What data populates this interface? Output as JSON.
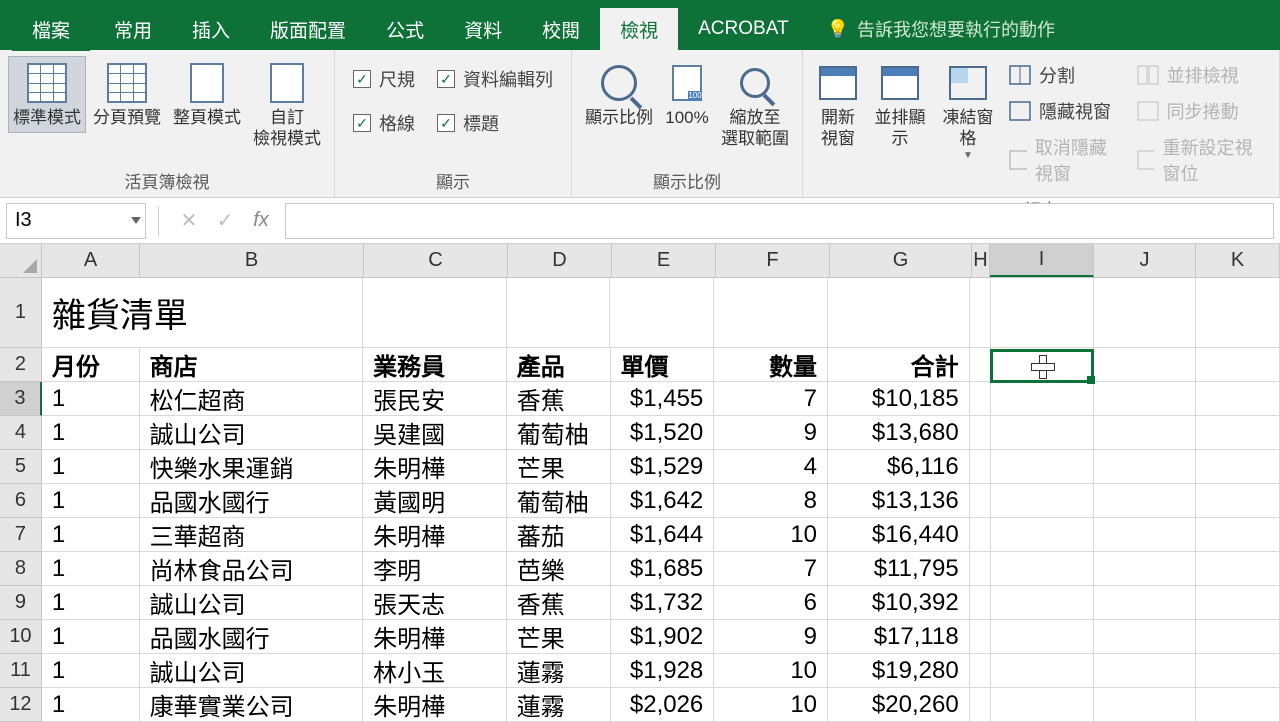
{
  "tabs": {
    "file": "檔案",
    "home": "常用",
    "insert": "插入",
    "layout": "版面配置",
    "formulas": "公式",
    "data": "資料",
    "review": "校閱",
    "view": "檢視",
    "acrobat": "ACROBAT",
    "tellme": "告訴我您想要執行的動作"
  },
  "ribbon": {
    "views": {
      "normal": "標準模式",
      "pagebreak": "分頁預覽",
      "pagelayout": "整頁模式",
      "custom": "自訂\n檢視模式",
      "group": "活頁簿檢視"
    },
    "show": {
      "ruler": "尺規",
      "formulabar": "資料編輯列",
      "gridlines": "格線",
      "headings": "標題",
      "group": "顯示"
    },
    "zoom": {
      "zoom": "顯示比例",
      "hundred": "100%",
      "selection": "縮放至\n選取範圍",
      "group": "顯示比例"
    },
    "window": {
      "new": "開新\n視窗",
      "arrange": "並排顯示",
      "freeze": "凍結窗格",
      "split": "分割",
      "hide": "隱藏視窗",
      "unhide": "取消隱藏視窗",
      "sidebyside": "並排檢視",
      "syncscroll": "同步捲動",
      "reset": "重新設定視窗位",
      "group": "視窗"
    }
  },
  "fbar": {
    "name": "I3",
    "formula": ""
  },
  "cols": [
    "A",
    "B",
    "C",
    "D",
    "E",
    "F",
    "G",
    "H",
    "I",
    "J",
    "K"
  ],
  "activeCol": "I",
  "activeRow": "3",
  "title": "雜貨清單",
  "headers": {
    "month": "月份",
    "store": "商店",
    "sales": "業務員",
    "product": "產品",
    "price": "單價",
    "qty": "數量",
    "total": "合計"
  },
  "rows": [
    {
      "n": "3",
      "m": "1",
      "s": "松仁超商",
      "sp": "張民安",
      "p": "香蕉",
      "pr": "$1,455",
      "q": "7",
      "t": "$10,185"
    },
    {
      "n": "4",
      "m": "1",
      "s": "誠山公司",
      "sp": "吳建國",
      "p": "葡萄柚",
      "pr": "$1,520",
      "q": "9",
      "t": "$13,680"
    },
    {
      "n": "5",
      "m": "1",
      "s": "快樂水果運銷",
      "sp": "朱明樺",
      "p": "芒果",
      "pr": "$1,529",
      "q": "4",
      "t": "$6,116"
    },
    {
      "n": "6",
      "m": "1",
      "s": "品國水國行",
      "sp": "黃國明",
      "p": "葡萄柚",
      "pr": "$1,642",
      "q": "8",
      "t": "$13,136"
    },
    {
      "n": "7",
      "m": "1",
      "s": "三華超商",
      "sp": "朱明樺",
      "p": "蕃茄",
      "pr": "$1,644",
      "q": "10",
      "t": "$16,440"
    },
    {
      "n": "8",
      "m": "1",
      "s": "尚林食品公司",
      "sp": "李明",
      "p": "芭樂",
      "pr": "$1,685",
      "q": "7",
      "t": "$11,795"
    },
    {
      "n": "9",
      "m": "1",
      "s": "誠山公司",
      "sp": "張天志",
      "p": "香蕉",
      "pr": "$1,732",
      "q": "6",
      "t": "$10,392"
    },
    {
      "n": "10",
      "m": "1",
      "s": "品國水國行",
      "sp": "朱明樺",
      "p": "芒果",
      "pr": "$1,902",
      "q": "9",
      "t": "$17,118"
    },
    {
      "n": "11",
      "m": "1",
      "s": "誠山公司",
      "sp": "林小玉",
      "p": "蓮霧",
      "pr": "$1,928",
      "q": "10",
      "t": "$19,280"
    },
    {
      "n": "12",
      "m": "1",
      "s": "康華實業公司",
      "sp": "朱明樺",
      "p": "蓮霧",
      "pr": "$2,026",
      "q": "10",
      "t": "$20,260"
    }
  ]
}
